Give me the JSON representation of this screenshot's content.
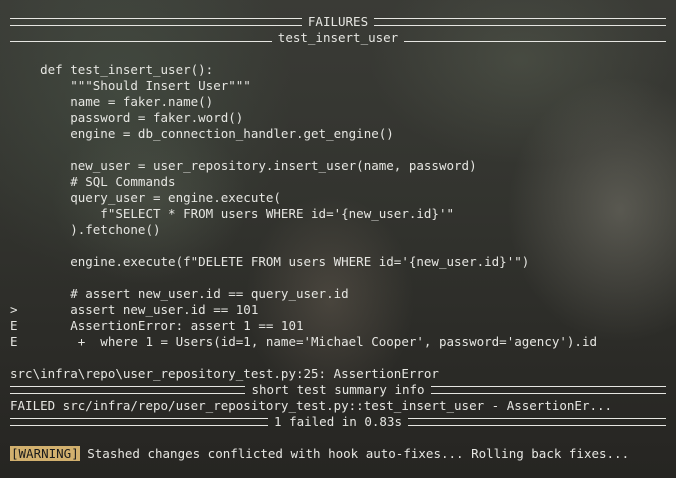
{
  "header_failures": "FAILURES",
  "header_test": "test_insert_user",
  "code_lines": [
    "    def test_insert_user():",
    "        \"\"\"Should Insert User\"\"\"",
    "        name = faker.name()",
    "        password = faker.word()",
    "        engine = db_connection_handler.get_engine()",
    "",
    "        new_user = user_repository.insert_user(name, password)",
    "        # SQL Commands",
    "        query_user = engine.execute(",
    "            f\"SELECT * FROM users WHERE id='{new_user.id}'\"",
    "        ).fetchone()",
    "",
    "        engine.execute(f\"DELETE FROM users WHERE id='{new_user.id}'\")",
    "",
    "        # assert new_user.id == query_user.id",
    ">       assert new_user.id == 101",
    "E       AssertionError: assert 1 == 101",
    "E        +  where 1 = Users(id=1, name='Michael Cooper', password='agency').id",
    "",
    "src\\infra\\repo\\user_repository_test.py:25: AssertionError"
  ],
  "header_summary": "short test summary info",
  "failed_line": "FAILED src/infra/repo/user_repository_test.py::test_insert_user - AssertionEr...",
  "header_result": "1 failed in 0.83s",
  "warning_badge": "[WARNING]",
  "warning_text": " Stashed changes conflicted with hook auto-fixes... Rolling back fixes...",
  "colors": {
    "text": "#e6e6e2",
    "warning_bg": "#d2b06e",
    "warning_fg": "#1b1b1b"
  }
}
